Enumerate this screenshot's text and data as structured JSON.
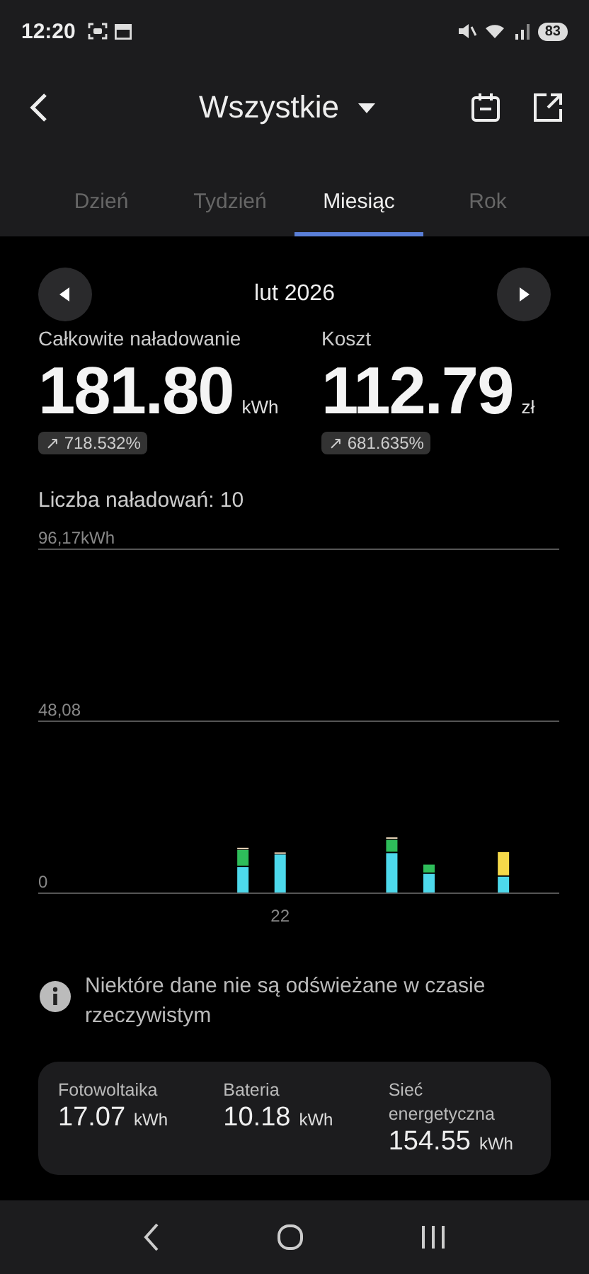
{
  "status_bar": {
    "time": "12:20",
    "battery": "83"
  },
  "header": {
    "title": "Wszystkie"
  },
  "tabs": [
    {
      "label": "Dzień",
      "selected": false
    },
    {
      "label": "Tydzień",
      "selected": false
    },
    {
      "label": "Miesiąc",
      "selected": true
    },
    {
      "label": "Rok",
      "selected": false
    }
  ],
  "period": {
    "label": "lut 2026"
  },
  "stats": [
    {
      "label": "Całkowite naładowanie",
      "value": "181.80",
      "unit": "kWh",
      "change": "↗ 718.532%"
    },
    {
      "label": "Koszt",
      "value": "112.79",
      "unit": "zł",
      "change": "↗ 681.635%"
    }
  ],
  "charge_count": "Liczba naładowań: 10",
  "chart": {
    "chart_data": {
      "type": "bar",
      "stacked": true,
      "annotations": [
        "22"
      ],
      "ylim": [
        0,
        96.17
      ],
      "yticks": [
        {
          "value": 0,
          "label": "0"
        },
        {
          "value": 48.08,
          "label": "48,08"
        },
        {
          "value": 96.17,
          "label": "96,17kWh"
        }
      ],
      "series": [
        {
          "color": "#4dd9ec",
          "values": [
            7.5,
            11.0,
            11.4,
            5.6,
            4.8
          ]
        },
        {
          "color": "#2ebd5a",
          "values": [
            4.8,
            null,
            3.7,
            2.6,
            null
          ]
        },
        {
          "color": "#f5d94a",
          "values": [
            null,
            null,
            null,
            null,
            6.9
          ]
        },
        {
          "color": "#f0dcc0",
          "values": [
            0.6,
            0.6,
            0.7,
            null,
            null
          ]
        }
      ]
    }
  },
  "notice": "Niektóre dane nie są odświeżane w czasie rzeczywistym",
  "sources": [
    {
      "label": "Fotowoltaika",
      "value": "17.07",
      "unit": "kWh"
    },
    {
      "label": "Bateria",
      "value": "10.18",
      "unit": "kWh"
    },
    {
      "label": "Sieć energetyczna",
      "value": "154.55",
      "unit": "kWh"
    }
  ]
}
